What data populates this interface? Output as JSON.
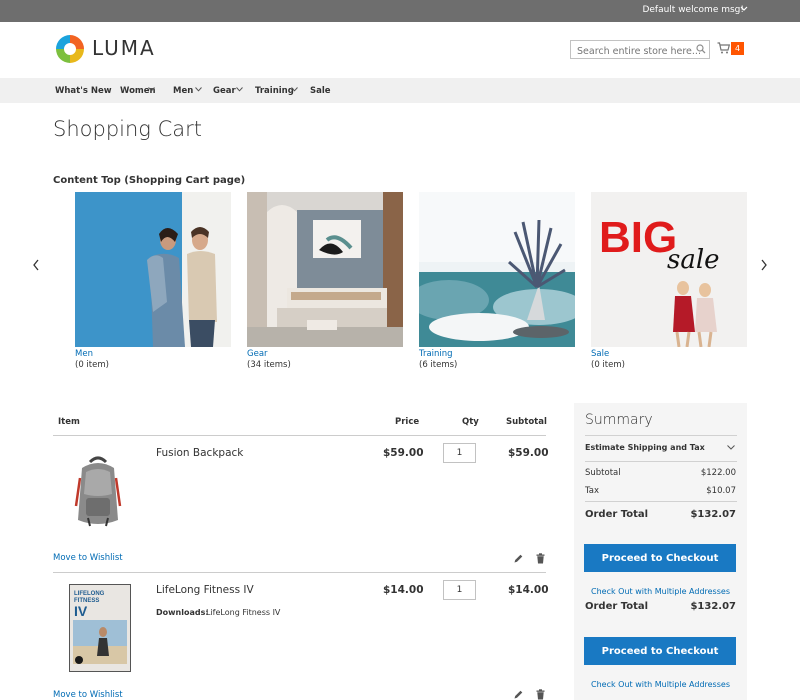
{
  "header": {
    "welcome": "Default welcome msg!",
    "logo_text": "LUMA",
    "search_placeholder": "Search entire store here...",
    "cart_count": "4"
  },
  "nav": {
    "items": [
      {
        "label": "What's New",
        "has_dropdown": false
      },
      {
        "label": "Women",
        "has_dropdown": true
      },
      {
        "label": "Men",
        "has_dropdown": true
      },
      {
        "label": "Gear",
        "has_dropdown": true
      },
      {
        "label": "Training",
        "has_dropdown": true
      },
      {
        "label": "Sale",
        "has_dropdown": false
      }
    ]
  },
  "page": {
    "title": "Shopping Cart",
    "content_top_title": "Content Top (Shopping Cart page)"
  },
  "carousel": {
    "items": [
      {
        "name": "Men",
        "count": "(0 item)"
      },
      {
        "name": "Gear",
        "count": "(34 items)"
      },
      {
        "name": "Training",
        "count": "(6 items)"
      },
      {
        "name": "Sale",
        "count": "(0 item)"
      }
    ],
    "sale_banner": {
      "big": "BIG",
      "sale": "sale"
    }
  },
  "cart": {
    "headers": {
      "item": "Item",
      "price": "Price",
      "qty": "Qty",
      "subtotal": "Subtotal"
    },
    "items": [
      {
        "name": "Fusion Backpack",
        "price": "$59.00",
        "qty": "1",
        "subtotal": "$59.00",
        "wishlist": "Move to Wishlist"
      },
      {
        "name": "LifeLong Fitness IV",
        "price": "$14.00",
        "qty": "1",
        "subtotal": "$14.00",
        "wishlist": "Move to Wishlist",
        "downloads_label": "Downloads:",
        "downloads_value": "LifeLong Fitness IV",
        "dvd_title_lines": [
          "LIFELONG",
          "FITNESS",
          "IV"
        ]
      }
    ]
  },
  "summary": {
    "title": "Summary",
    "estimate_label": "Estimate Shipping and Tax",
    "subtotal_label": "Subtotal",
    "subtotal_value": "$122.00",
    "tax_label": "Tax",
    "tax_value": "$10.07",
    "order_total_label": "Order Total",
    "order_total_value": "$132.07",
    "checkout_label": "Proceed to Checkout",
    "multi_address_label": "Check Out with Multiple Addresses"
  },
  "colors": {
    "topbar": "#6e6e6e",
    "nav_bg": "#f0f0f0",
    "link": "#006bb4",
    "primary_button": "#1979c3",
    "cart_badge": "#ff5501",
    "summary_bg": "#f5f5f5"
  }
}
